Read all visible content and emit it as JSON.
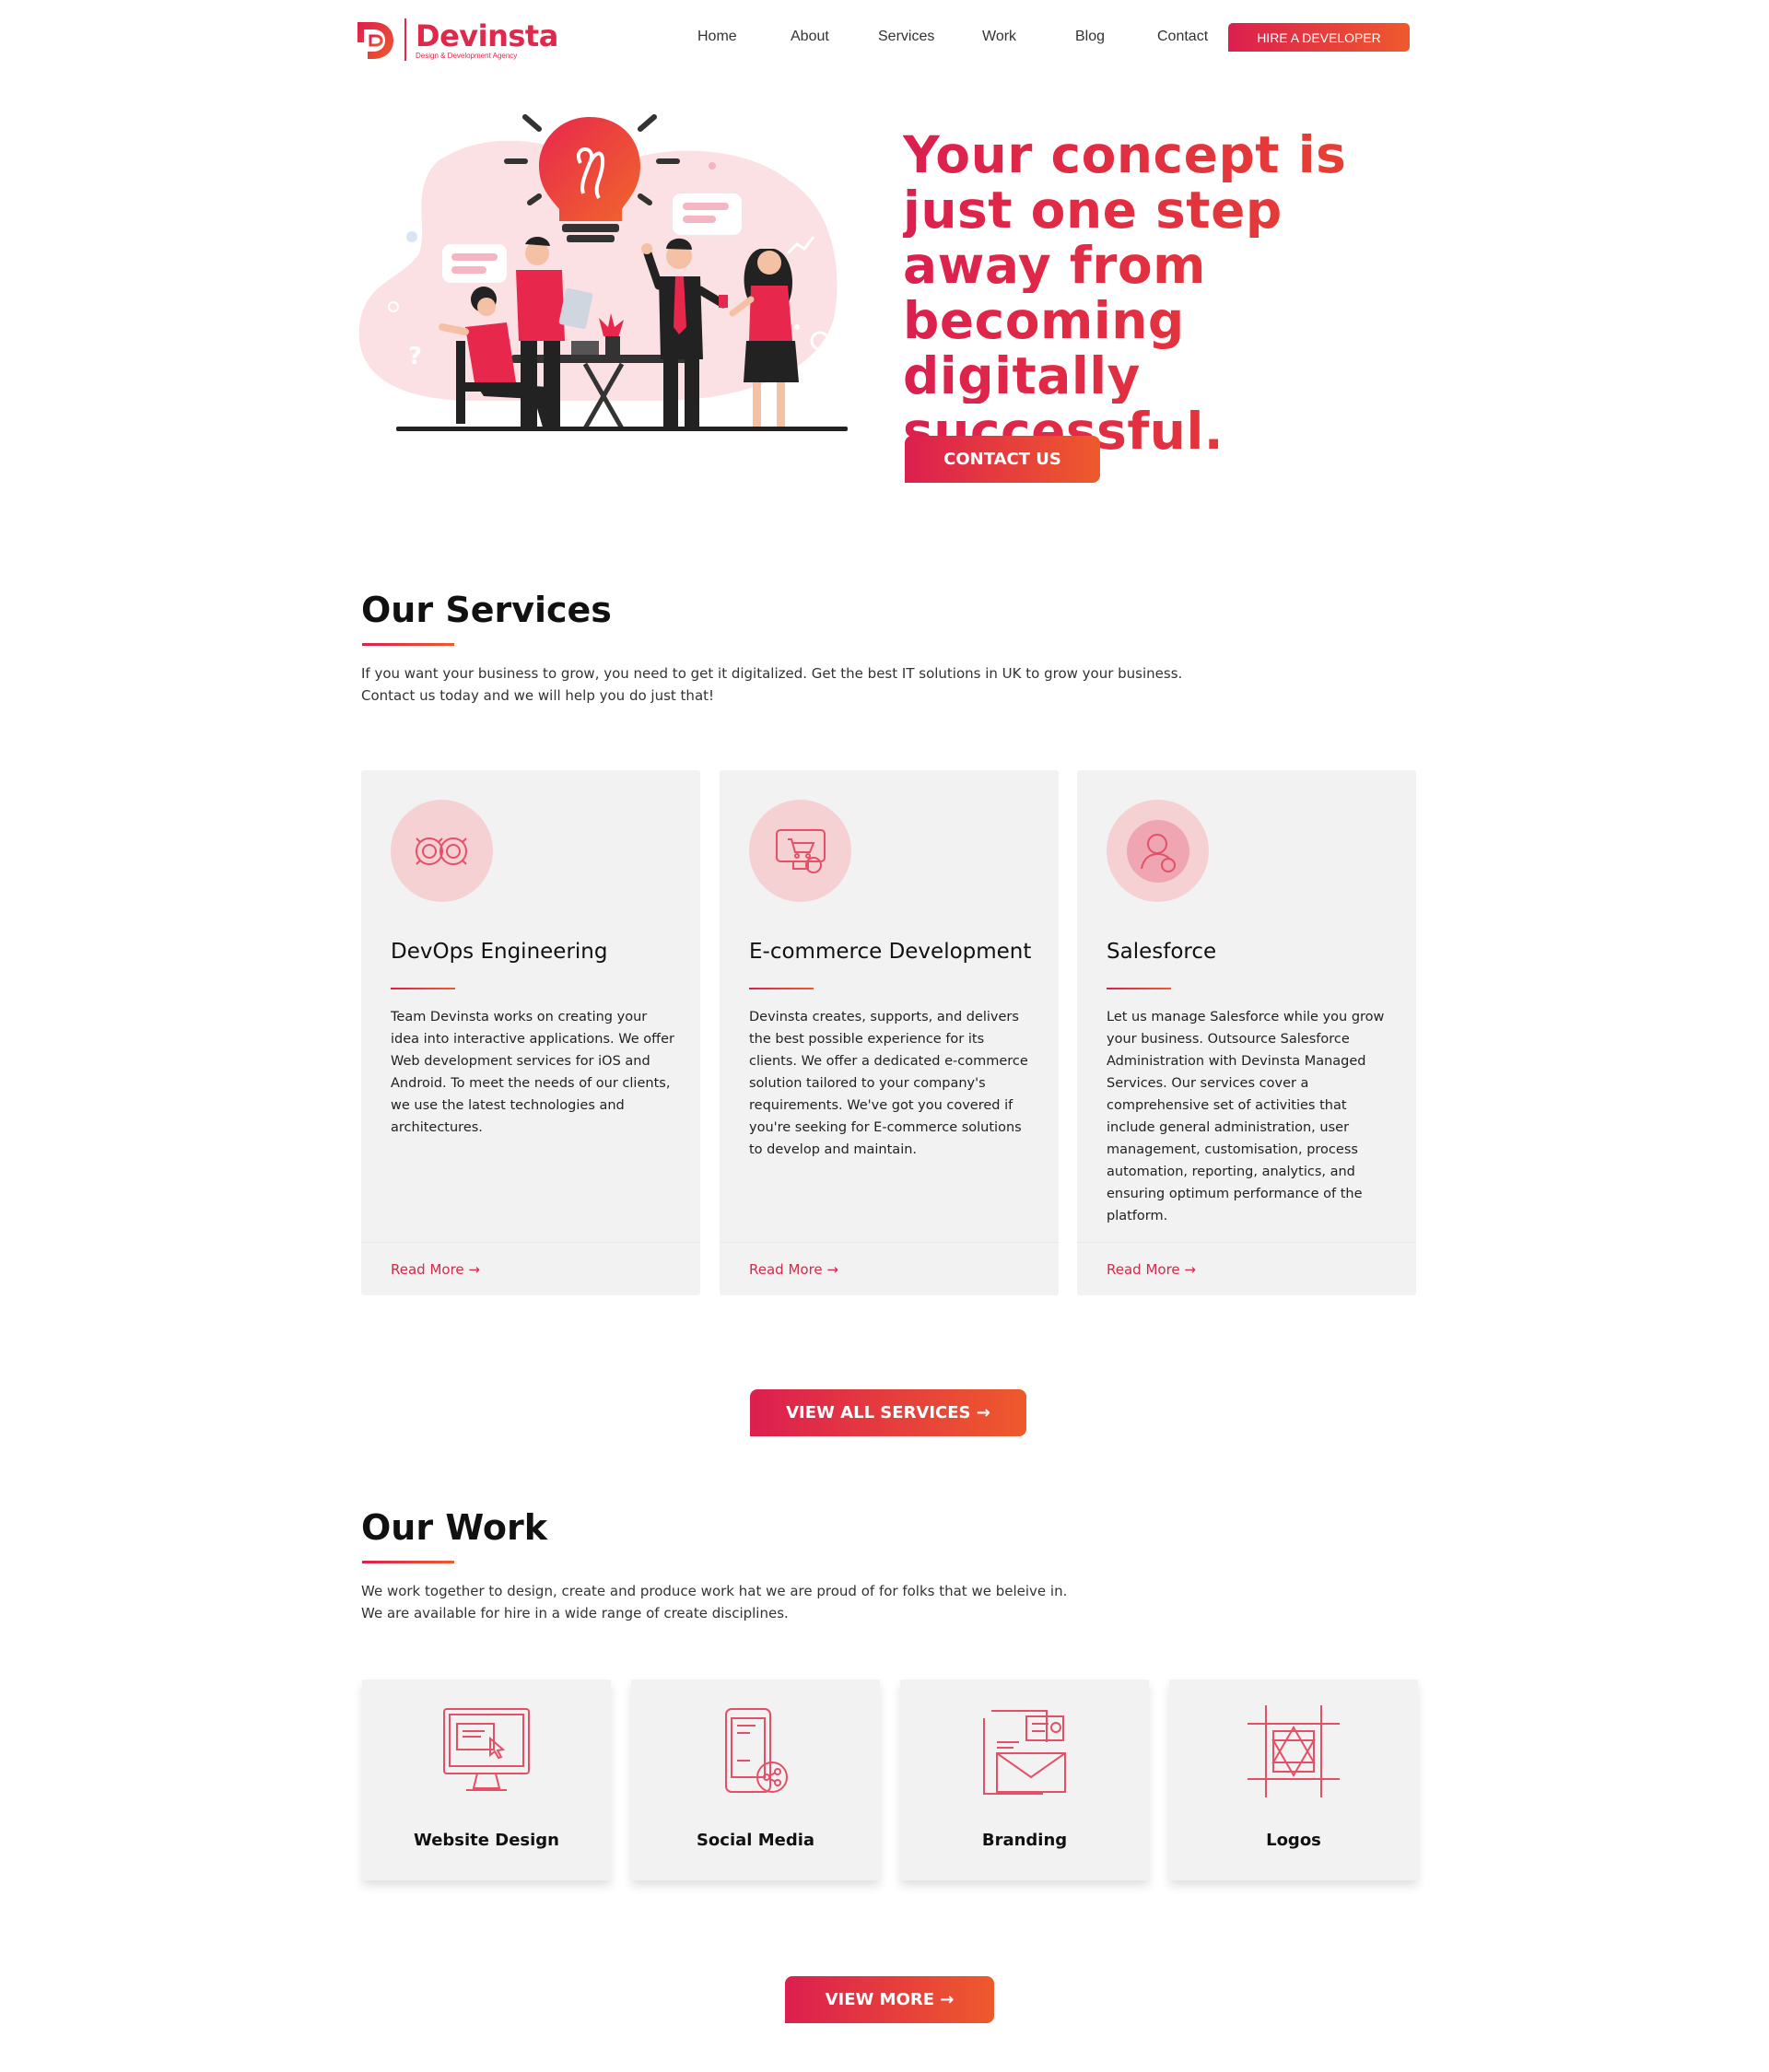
{
  "brand": {
    "name": "Devinsta",
    "tagline": "Design & Development Agency"
  },
  "nav": {
    "items": [
      "Home",
      "About",
      "Services",
      "Work",
      "Blog",
      "Contact"
    ],
    "hire_label": "HIRE A DEVELOPER"
  },
  "hero": {
    "title_lines": [
      "Your concept is",
      "just one step",
      "away from",
      "becoming digitally",
      "successful."
    ],
    "cta_label": "CONTACT US"
  },
  "services": {
    "title": "Our Services",
    "desc_lines": [
      "If you want your business to grow, you need to get it digitalized. Get the best IT solutions in UK to grow your business.",
      "Contact us today and we will help you do just that!"
    ],
    "cards": [
      {
        "icon": "devops-icon",
        "title": "DevOps Engineering",
        "desc": "Team Devinsta works on creating your idea into interactive applications. We offer Web development services for iOS and Android. To meet the needs of our clients, we use the latest technologies and architectures.",
        "link": "Read More →"
      },
      {
        "icon": "ecommerce-icon",
        "title": "E-commerce Development",
        "desc": "Devinsta creates, supports, and delivers the best possible experience for its clients. We offer a dedicated e-commerce solution tailored to your company's requirements. We've got you covered if you're seeking for E-commerce solutions to develop and maintain.",
        "link": "Read More →"
      },
      {
        "icon": "salesforce-icon",
        "title": "Salesforce",
        "desc": "Let us manage Salesforce while you grow your business. Outsource Salesforce Administration with Devinsta Managed Services. Our services cover a comprehensive set of activities that include general administration, user management, customisation, process automation, reporting, analytics, and ensuring optimum performance of the platform.",
        "link": "Read More →"
      }
    ],
    "view_all_label": "VIEW ALL SERVICES →"
  },
  "work": {
    "title": "Our Work",
    "desc_lines": [
      "We work together to design, create and produce work hat we are proud of for folks that we beleive in.",
      "We are available for hire in a wide range of create disciplines."
    ],
    "cards": [
      {
        "icon": "monitor-design-icon",
        "label": "Website Design"
      },
      {
        "icon": "social-phone-icon",
        "label": "Social Media"
      },
      {
        "icon": "branding-envelope-icon",
        "label": "Branding"
      },
      {
        "icon": "logo-grid-icon",
        "label": "Logos"
      }
    ],
    "view_more_label": "VIEW MORE →"
  },
  "colors": {
    "accent_start": "#dc1f4f",
    "accent_end": "#ee5a2c",
    "card_bg": "#f2f2f2",
    "icon_circle": "#f6d1d3"
  }
}
